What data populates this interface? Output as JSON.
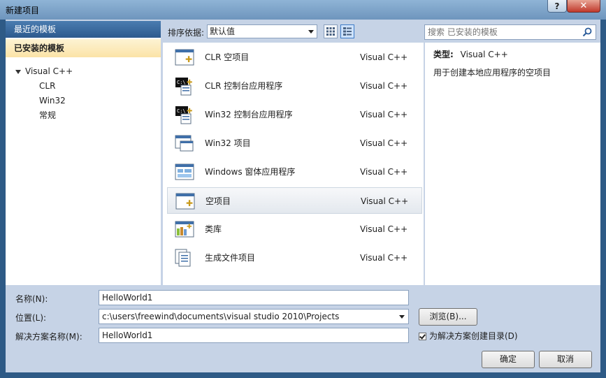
{
  "window": {
    "title": "新建项目",
    "help": "?",
    "close": "✕"
  },
  "sidebar": {
    "recent": "最近的模板",
    "installed": "已安装的模板",
    "tree": {
      "root": "Visual C++",
      "children": [
        "CLR",
        "Win32",
        "常规"
      ]
    }
  },
  "toolbar": {
    "sort_label": "排序依据:",
    "sort_value": "默认值",
    "search_placeholder": "搜索 已安装的模板"
  },
  "templates": [
    {
      "name": "CLR 空项目",
      "lang": "Visual C++",
      "icon": "empty-project-icon"
    },
    {
      "name": "CLR 控制台应用程序",
      "lang": "Visual C++",
      "icon": "console-app-icon"
    },
    {
      "name": "Win32 控制台应用程序",
      "lang": "Visual C++",
      "icon": "console-app-icon"
    },
    {
      "name": "Win32 项目",
      "lang": "Visual C++",
      "icon": "win32-project-icon"
    },
    {
      "name": "Windows 窗体应用程序",
      "lang": "Visual C++",
      "icon": "forms-app-icon"
    },
    {
      "name": "空项目",
      "lang": "Visual C++",
      "icon": "empty-project-icon",
      "selected": true
    },
    {
      "name": "类库",
      "lang": "Visual C++",
      "icon": "class-library-icon"
    },
    {
      "name": "生成文件项目",
      "lang": "Visual C++",
      "icon": "makefile-project-icon"
    }
  ],
  "details": {
    "type_label": "类型:",
    "type_value": "Visual C++",
    "description": "用于创建本地应用程序的空项目"
  },
  "form": {
    "name_label": "名称(N):",
    "name_value": "HelloWorld1",
    "location_label": "位置(L):",
    "location_value": "c:\\users\\freewind\\documents\\visual studio 2010\\Projects",
    "solution_label": "解决方案名称(M):",
    "solution_value": "HelloWorld1",
    "browse": "浏览(B)...",
    "create_dir_label": "为解决方案创建目录(D)",
    "ok": "确定",
    "cancel": "取消"
  }
}
